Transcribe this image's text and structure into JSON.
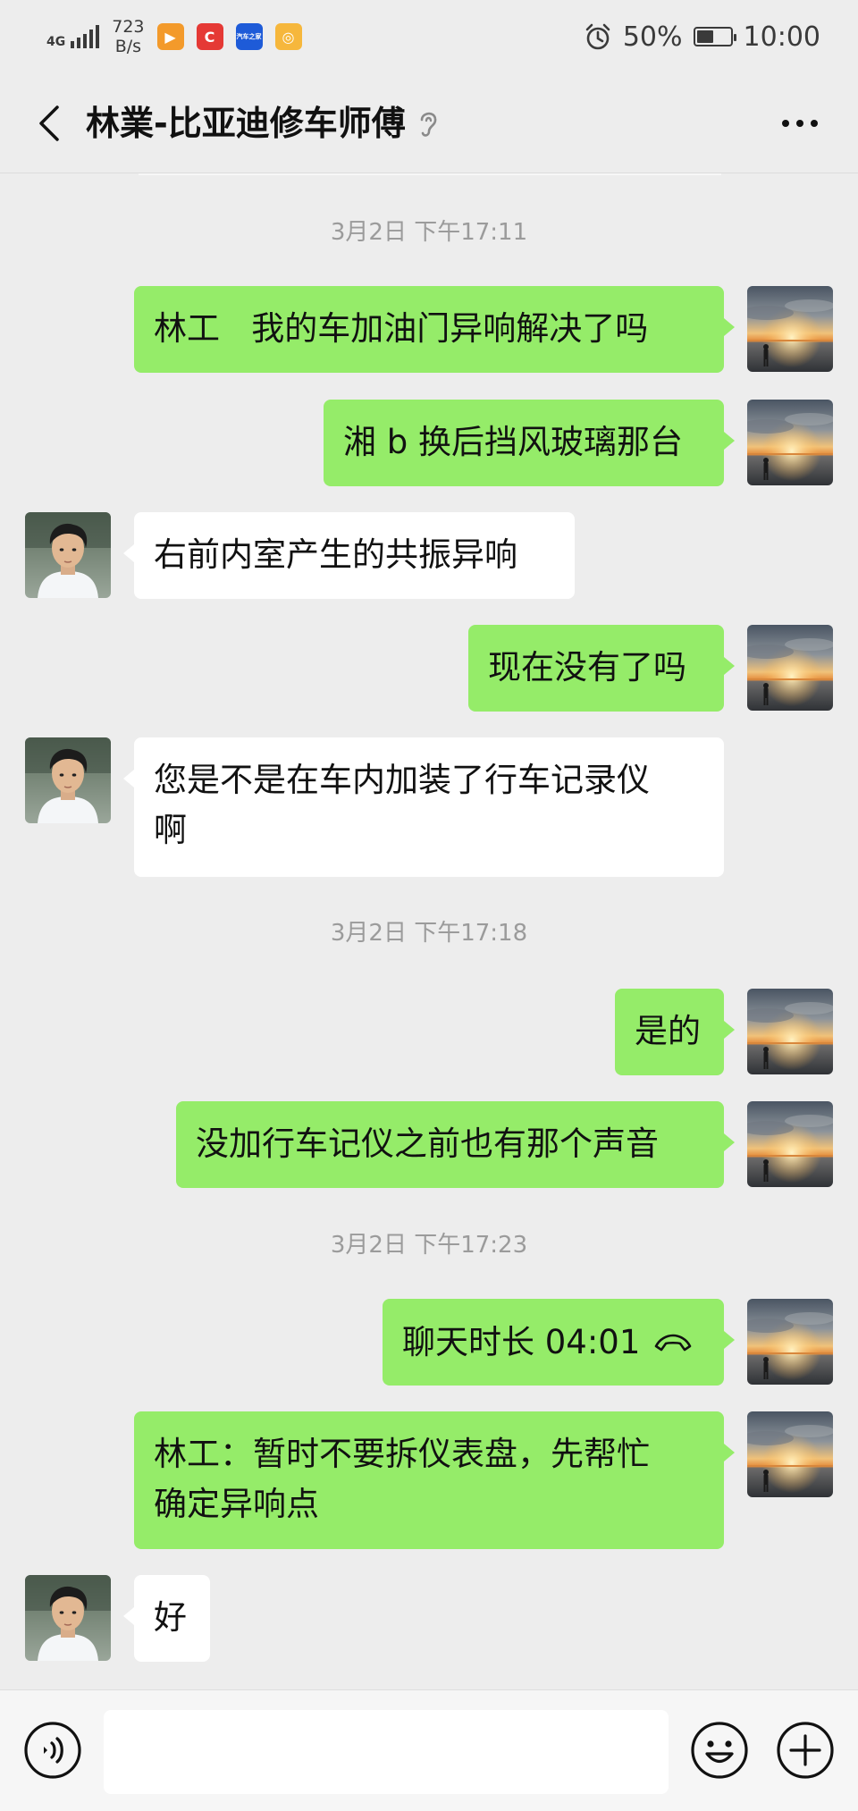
{
  "status_bar": {
    "network": "4G",
    "speed_value": "723",
    "speed_unit": "B/s",
    "battery": "50%",
    "battery_level": 0.5,
    "time": "10:00",
    "app_badge_text": "汽车之家"
  },
  "header": {
    "title": "林業-比亚迪修车师傅"
  },
  "colors": {
    "my_bubble": "#95ec69",
    "other_bubble": "#ffffff",
    "background": "#ededed"
  },
  "timestamps": [
    "3月2日 下午17:11",
    "3月2日 下午17:18",
    "3月2日 下午17:23"
  ],
  "messages": [
    {
      "from": "me",
      "text": "林工   我的车加油门异响解决了吗"
    },
    {
      "from": "me",
      "text": "湘 b 换后挡风玻璃那台"
    },
    {
      "from": "other",
      "text": "右前内室产生的共振异响"
    },
    {
      "from": "me",
      "text": "现在没有了吗"
    },
    {
      "from": "other",
      "text": "您是不是在车内加装了行车记录仪\n啊"
    },
    {
      "from": "me",
      "text": "是的"
    },
    {
      "from": "me",
      "text": "没加行车记仪之前也有那个声音"
    },
    {
      "from": "me",
      "text": "聊天时长 04:01"
    },
    {
      "from": "me",
      "text": "林工：暂时不要拆仪表盘，先帮忙\n确定异响点"
    },
    {
      "from": "other",
      "text": "好"
    }
  ]
}
